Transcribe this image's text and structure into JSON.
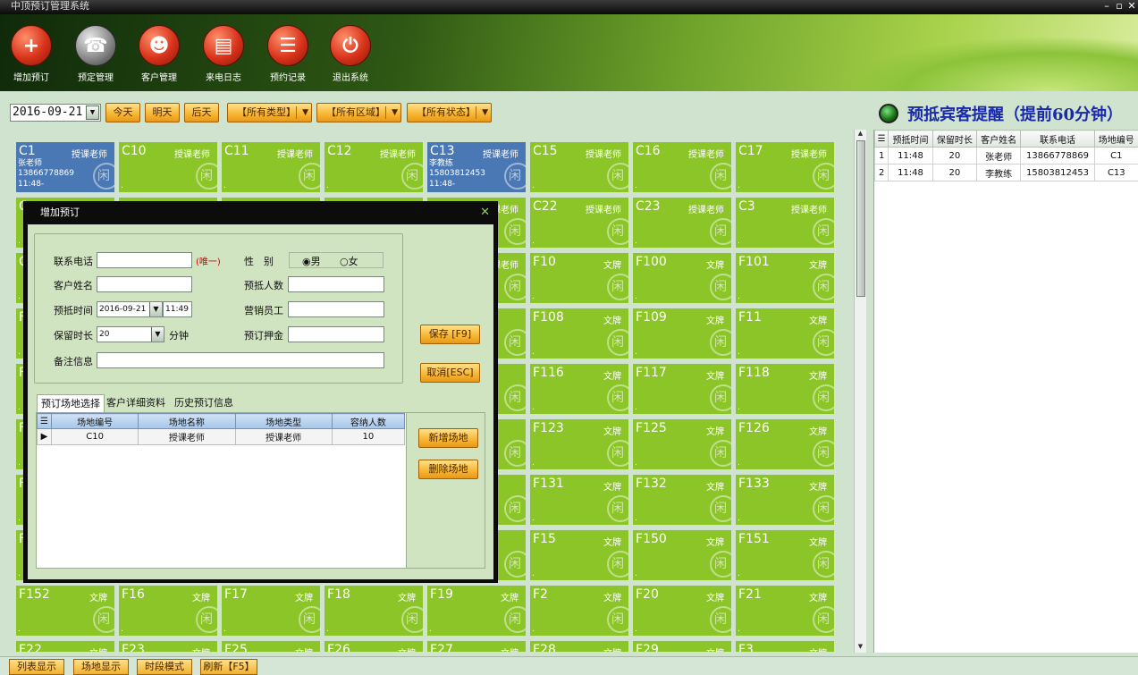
{
  "app": {
    "title": "中顶预订管理系统",
    "win_controls": [
      "–",
      "▫",
      "✕"
    ]
  },
  "toolbar": [
    {
      "label": "增加预订",
      "icon": "add-phone-icon",
      "glyph": "+",
      "style": "red"
    },
    {
      "label": "预定管理",
      "icon": "phone-icon",
      "glyph": "☎",
      "style": "grey"
    },
    {
      "label": "客户管理",
      "icon": "users-icon",
      "glyph": "☻",
      "style": "red"
    },
    {
      "label": "来电日志",
      "icon": "call-log-icon",
      "glyph": "▤",
      "style": "red"
    },
    {
      "label": "预约记录",
      "icon": "records-icon",
      "glyph": "☰",
      "style": "red"
    },
    {
      "label": "退出系统",
      "icon": "power-icon",
      "glyph": "⏻",
      "style": "red"
    }
  ],
  "filters": {
    "date": "2016-09-21",
    "today": "今天",
    "tomorrow": "明天",
    "after_tomorrow": "后天",
    "type": "【所有类型】",
    "area": "【所有区域】",
    "status": "【所有状态】"
  },
  "reminder": {
    "title": "预抵宾客提醒（提前60分钟）"
  },
  "reminder_table": {
    "headers": [
      "预抵时间",
      "保留时长",
      "客户姓名",
      "联系电话",
      "场地编号"
    ],
    "rows": [
      [
        "1",
        "11:48",
        "20",
        "张老师",
        "13866778869",
        "C1"
      ],
      [
        "2",
        "11:48",
        "20",
        "李教练",
        "15803812453",
        "C13"
      ]
    ]
  },
  "tiles": [
    {
      "code": "C1",
      "type": "授课老师",
      "l1": "张老师",
      "l2": "13866778869",
      "l3": "11:48-",
      "state": "booked"
    },
    {
      "code": "C10",
      "type": "授课老师",
      "state": "free"
    },
    {
      "code": "C11",
      "type": "授课老师",
      "state": "free"
    },
    {
      "code": "C12",
      "type": "授课老师",
      "state": "free"
    },
    {
      "code": "C13",
      "type": "授课老师",
      "l1": "李教练",
      "l2": "15803812453",
      "l3": "11:48-",
      "state": "booked"
    },
    {
      "code": "C15",
      "type": "授课老师",
      "state": "free"
    },
    {
      "code": "C16",
      "type": "授课老师",
      "state": "free"
    },
    {
      "code": "C17",
      "type": "授课老师",
      "state": "free"
    },
    {
      "code": "C",
      "type": "",
      "state": "free"
    },
    {
      "code": "",
      "type": "",
      "state": "free"
    },
    {
      "code": "",
      "type": "",
      "state": "free"
    },
    {
      "code": "",
      "type": "",
      "state": "free"
    },
    {
      "code": "",
      "type": "授课老师",
      "state": "free"
    },
    {
      "code": "C22",
      "type": "授课老师",
      "state": "free"
    },
    {
      "code": "C23",
      "type": "授课老师",
      "state": "free"
    },
    {
      "code": "C3",
      "type": "授课老师",
      "state": "free"
    },
    {
      "code": "C",
      "type": "",
      "state": "free"
    },
    {
      "code": "",
      "type": "",
      "state": "free"
    },
    {
      "code": "",
      "type": "",
      "state": "free"
    },
    {
      "code": "",
      "type": "",
      "state": "free"
    },
    {
      "code": "",
      "type": "授课老师",
      "state": "free"
    },
    {
      "code": "F10",
      "type": "文牌",
      "state": "free"
    },
    {
      "code": "F100",
      "type": "文牌",
      "state": "free"
    },
    {
      "code": "F101",
      "type": "文牌",
      "state": "free"
    },
    {
      "code": "F",
      "type": "",
      "state": "free"
    },
    {
      "code": "",
      "type": "",
      "state": "free"
    },
    {
      "code": "",
      "type": "",
      "state": "free"
    },
    {
      "code": "",
      "type": "",
      "state": "free"
    },
    {
      "code": "",
      "type": "",
      "state": "free"
    },
    {
      "code": "F108",
      "type": "文牌",
      "state": "free"
    },
    {
      "code": "F109",
      "type": "文牌",
      "state": "free"
    },
    {
      "code": "F11",
      "type": "文牌",
      "state": "free"
    },
    {
      "code": "F",
      "type": "",
      "state": "free"
    },
    {
      "code": "",
      "type": "",
      "state": "free"
    },
    {
      "code": "",
      "type": "",
      "state": "free"
    },
    {
      "code": "",
      "type": "",
      "state": "free"
    },
    {
      "code": "",
      "type": "",
      "state": "free"
    },
    {
      "code": "F116",
      "type": "文牌",
      "state": "free"
    },
    {
      "code": "F117",
      "type": "文牌",
      "state": "free"
    },
    {
      "code": "F118",
      "type": "文牌",
      "state": "free"
    },
    {
      "code": "F",
      "type": "",
      "state": "free"
    },
    {
      "code": "",
      "type": "",
      "state": "free"
    },
    {
      "code": "",
      "type": "",
      "state": "free"
    },
    {
      "code": "",
      "type": "",
      "state": "free"
    },
    {
      "code": "",
      "type": "",
      "state": "free"
    },
    {
      "code": "F123",
      "type": "文牌",
      "state": "free"
    },
    {
      "code": "F125",
      "type": "文牌",
      "state": "free"
    },
    {
      "code": "F126",
      "type": "文牌",
      "state": "free"
    },
    {
      "code": "F",
      "type": "",
      "state": "free"
    },
    {
      "code": "",
      "type": "",
      "state": "free"
    },
    {
      "code": "",
      "type": "",
      "state": "free"
    },
    {
      "code": "",
      "type": "",
      "state": "free"
    },
    {
      "code": "",
      "type": "",
      "state": "free"
    },
    {
      "code": "F131",
      "type": "文牌",
      "state": "free"
    },
    {
      "code": "F132",
      "type": "文牌",
      "state": "free"
    },
    {
      "code": "F133",
      "type": "文牌",
      "state": "free"
    },
    {
      "code": "F",
      "type": "",
      "state": "free"
    },
    {
      "code": "",
      "type": "",
      "state": "free"
    },
    {
      "code": "",
      "type": "",
      "state": "free"
    },
    {
      "code": "",
      "type": "",
      "state": "free"
    },
    {
      "code": "",
      "type": "",
      "state": "free"
    },
    {
      "code": "F15",
      "type": "文牌",
      "state": "free"
    },
    {
      "code": "F150",
      "type": "文牌",
      "state": "free"
    },
    {
      "code": "F151",
      "type": "文牌",
      "state": "free"
    },
    {
      "code": "F152",
      "type": "文牌",
      "state": "free"
    },
    {
      "code": "F16",
      "type": "文牌",
      "state": "free"
    },
    {
      "code": "F17",
      "type": "文牌",
      "state": "free"
    },
    {
      "code": "F18",
      "type": "文牌",
      "state": "free"
    },
    {
      "code": "F19",
      "type": "文牌",
      "state": "free"
    },
    {
      "code": "F2",
      "type": "文牌",
      "state": "free"
    },
    {
      "code": "F20",
      "type": "文牌",
      "state": "free"
    },
    {
      "code": "F21",
      "type": "文牌",
      "state": "free"
    },
    {
      "code": "F22",
      "type": "文牌",
      "state": "free"
    },
    {
      "code": "F23",
      "type": "文牌",
      "state": "free"
    },
    {
      "code": "F25",
      "type": "文牌",
      "state": "free"
    },
    {
      "code": "F26",
      "type": "文牌",
      "state": "free"
    },
    {
      "code": "F27",
      "type": "文牌",
      "state": "free"
    },
    {
      "code": "F28",
      "type": "文牌",
      "state": "free"
    },
    {
      "code": "F29",
      "type": "文牌",
      "state": "free"
    },
    {
      "code": "F3",
      "type": "文牌",
      "state": "free"
    }
  ],
  "tile_badge": "闲",
  "dialog": {
    "title": "增加预订",
    "phone_label": "联系电话",
    "phone_value": "",
    "unique_tag": "(唯一)",
    "gender_label": "性　别",
    "male": "男",
    "female": "女",
    "name_label": "客户姓名",
    "name_value": "",
    "guests_label": "预抵人数",
    "guests_value": "",
    "time_label": "预抵时间",
    "date_value": "2016-09-21",
    "time_value": "11:49",
    "staff_label": "营销员工",
    "staff_value": "",
    "hold_label": "保留时长",
    "hold_value": "20",
    "hold_unit": "分钟",
    "deposit_label": "预订押金",
    "deposit_value": "",
    "note_label": "备注信息",
    "note_value": "",
    "save": "保存 [F9]",
    "cancel": "取消[ESC]",
    "tabs": [
      "预订场地选择",
      "客户详细资料",
      "历史预订信息"
    ],
    "table_headers": [
      "场地编号",
      "场地名称",
      "场地类型",
      "容纳人数"
    ],
    "table_rows": [
      [
        "C10",
        "授课老师",
        "授课老师",
        "10"
      ]
    ],
    "add_venue": "新增场地",
    "delete_venue": "删除场地"
  },
  "bottom": [
    "列表显示",
    "场地显示",
    "时段模式",
    "刷新【F5】"
  ]
}
